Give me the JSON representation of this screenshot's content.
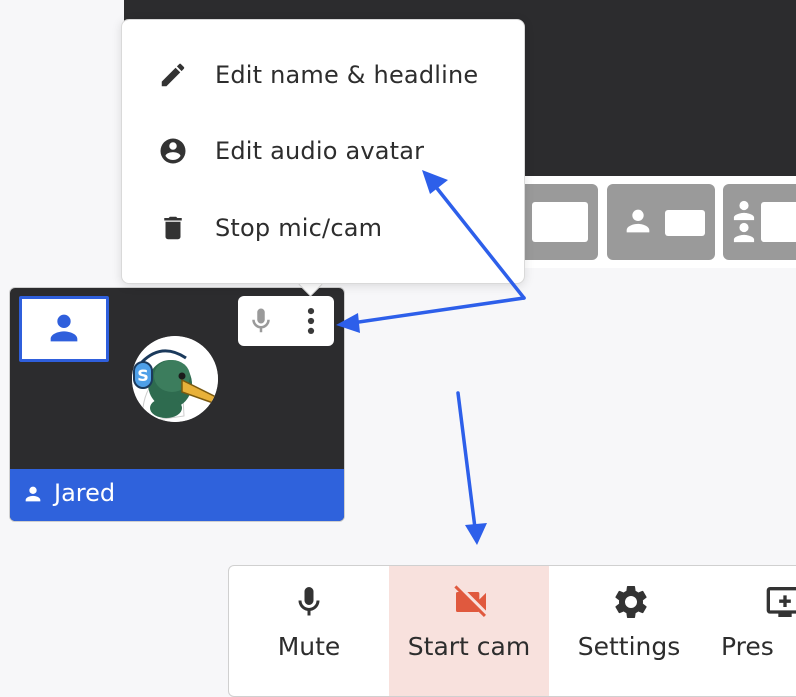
{
  "menu": {
    "items": [
      {
        "label": "Edit name & headline",
        "icon": "pencil-icon"
      },
      {
        "label": "Edit audio avatar",
        "icon": "account-circle-icon"
      },
      {
        "label": "Stop mic/cam",
        "icon": "trash-icon"
      }
    ]
  },
  "participant": {
    "name": "Jared",
    "avatar_icon": "duck-avatar"
  },
  "toolbar": {
    "buttons": [
      {
        "label": "Mute",
        "icon": "microphone-icon"
      },
      {
        "label": "Start cam",
        "icon": "camera-off-icon",
        "active": true
      },
      {
        "label": "Settings",
        "icon": "gear-icon"
      },
      {
        "label": "Pres",
        "icon": "present-screen-icon"
      }
    ]
  },
  "colors": {
    "accent_blue": "#2f62dc",
    "annotation_arrow": "#2d5fea",
    "dark_stage": "#2c2c2e",
    "active_button_bg": "#f8e1dd",
    "camera_off_red": "#e0593e"
  }
}
